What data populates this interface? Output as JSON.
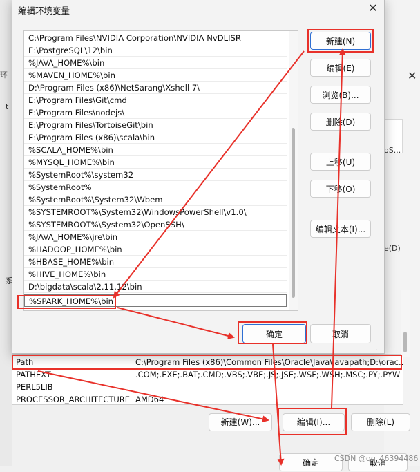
{
  "background_window": {
    "title_fragment": "环境",
    "left_fragment_1": "t",
    "left_fragment_2": "系",
    "right_fragment_os": "oS...",
    "right_fragment_d": "e(D)",
    "system_vars": [
      {
        "name": "Path",
        "value": "C:\\Program Files (x86)\\Common Files\\Oracle\\Java\\javapath;D:\\orac..."
      },
      {
        "name": "PATHEXT",
        "value": ".COM;.EXE;.BAT;.CMD;.VBS;.VBE;.JS;.JSE;.WSF;.WSH;.MSC;.PY;.PYW"
      },
      {
        "name": "PERL5LIB",
        "value": ""
      },
      {
        "name": "PROCESSOR_ARCHITECTURE",
        "value": "AMD64"
      }
    ],
    "buttons": {
      "new": "新建(W)...",
      "edit": "编辑(I)...",
      "delete": "删除(L)",
      "ok": "确定",
      "cancel": "取消"
    }
  },
  "dialog": {
    "title": "编辑环境变量",
    "paths": [
      "C:\\Program Files\\NVIDIA Corporation\\NVIDIA NvDLISR",
      "E:\\PostgreSQL\\12\\bin",
      "%JAVA_HOME%\\bin",
      "%MAVEN_HOME%\\bin",
      "D:\\Program Files (x86)\\NetSarang\\Xshell 7\\",
      "E:\\Program Files\\Git\\cmd",
      "E:\\Program Files\\nodejs\\",
      "E:\\Program Files\\TortoiseGit\\bin",
      "E:\\Program Files (x86)\\scala\\bin",
      "%SCALA_HOME%\\bin",
      "%MYSQL_HOME%\\bin",
      "%SystemRoot%\\system32",
      "%SystemRoot%",
      "%SystemRoot%\\System32\\Wbem",
      "%SYSTEMROOT%\\System32\\WindowsPowerShell\\v1.0\\",
      "%SYSTEMROOT%\\System32\\OpenSSH\\",
      "%JAVA_HOME%\\jre\\bin",
      "%HADOOP_HOME%\\bin",
      "%HBASE_HOME%\\bin",
      "%HIVE_HOME%\\bin",
      "D:\\bigdata\\scala\\2.11.12\\bin",
      "%SPARK_HOME%\\bin"
    ],
    "buttons": {
      "new": "新建(N)",
      "edit": "编辑(E)",
      "browse": "浏览(B)...",
      "delete": "删除(D)",
      "move_up": "上移(U)",
      "move_down": "下移(O)",
      "edit_text": "编辑文本(I)...",
      "ok": "确定",
      "cancel": "取消"
    }
  },
  "watermark": "CSDN @qq_46394486",
  "colors": {
    "annotation": "#e8312a",
    "focus": "#2f6fd3"
  }
}
